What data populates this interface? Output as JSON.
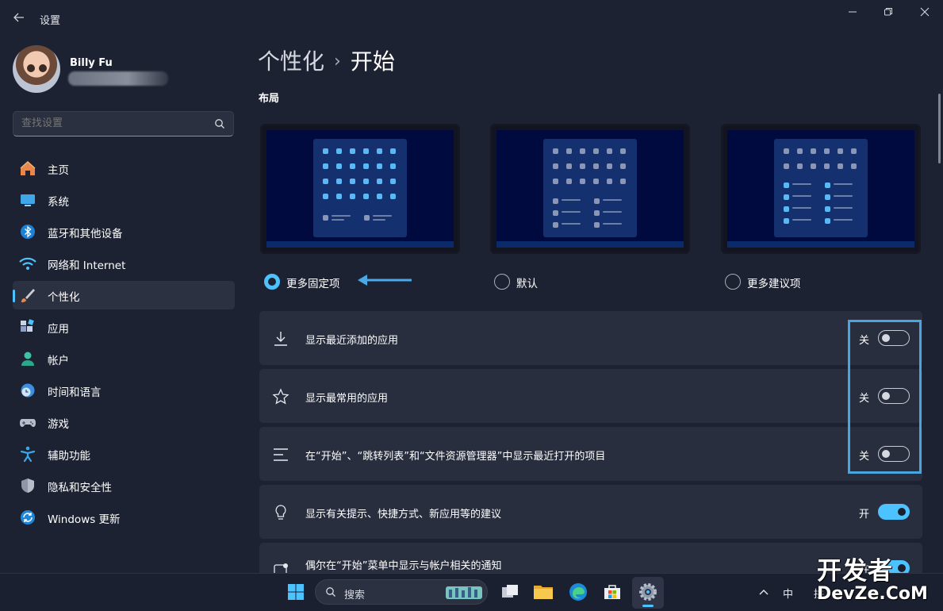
{
  "window": {
    "title": "设置"
  },
  "user": {
    "name": "Billy Fu"
  },
  "search": {
    "placeholder": "查找设置"
  },
  "sidebar": {
    "items": [
      {
        "label": "主页",
        "icon": "home-icon"
      },
      {
        "label": "系统",
        "icon": "system-icon"
      },
      {
        "label": "蓝牙和其他设备",
        "icon": "bluetooth-icon"
      },
      {
        "label": "网络和 Internet",
        "icon": "wifi-icon"
      },
      {
        "label": "个性化",
        "icon": "brush-icon",
        "active": true
      },
      {
        "label": "应用",
        "icon": "apps-icon"
      },
      {
        "label": "帐户",
        "icon": "account-icon"
      },
      {
        "label": "时间和语言",
        "icon": "clock-globe-icon"
      },
      {
        "label": "游戏",
        "icon": "gamepad-icon"
      },
      {
        "label": "辅助功能",
        "icon": "accessibility-icon"
      },
      {
        "label": "隐私和安全性",
        "icon": "shield-icon"
      },
      {
        "label": "Windows 更新",
        "icon": "update-icon"
      }
    ]
  },
  "header": {
    "parent": "个性化",
    "separator": "›",
    "current": "开始"
  },
  "layout_section": {
    "title": "布局",
    "options": [
      {
        "label": "更多固定项",
        "selected": true
      },
      {
        "label": "默认",
        "selected": false
      },
      {
        "label": "更多建议项",
        "selected": false
      }
    ]
  },
  "settings": [
    {
      "label": "显示最近添加的应用",
      "state": "关",
      "on": false,
      "icon": "download-icon"
    },
    {
      "label": "显示最常用的应用",
      "state": "关",
      "on": false,
      "icon": "star-icon"
    },
    {
      "label": "在“开始”、“跳转列表”和“文件资源管理器”中显示最近打开的项目",
      "state": "关",
      "on": false,
      "icon": "list-icon"
    },
    {
      "label": "显示有关提示、快捷方式、新应用等的建议",
      "state": "开",
      "on": true,
      "icon": "lightbulb-icon"
    },
    {
      "label": "偶尔在“开始”菜单中显示与帐户相关的通知",
      "state": "开",
      "on": true,
      "icon": "notification-icon"
    }
  ],
  "taskbar": {
    "search_label": "搜索",
    "ime": "中",
    "tray_char": "拼"
  },
  "watermark": {
    "line1": "开发者",
    "line2": "DevZe.CoM"
  },
  "colors": {
    "accent": "#4cc2ff",
    "highlight": "#47a6e0",
    "background": "#1d2232",
    "card": "#292e3e"
  }
}
